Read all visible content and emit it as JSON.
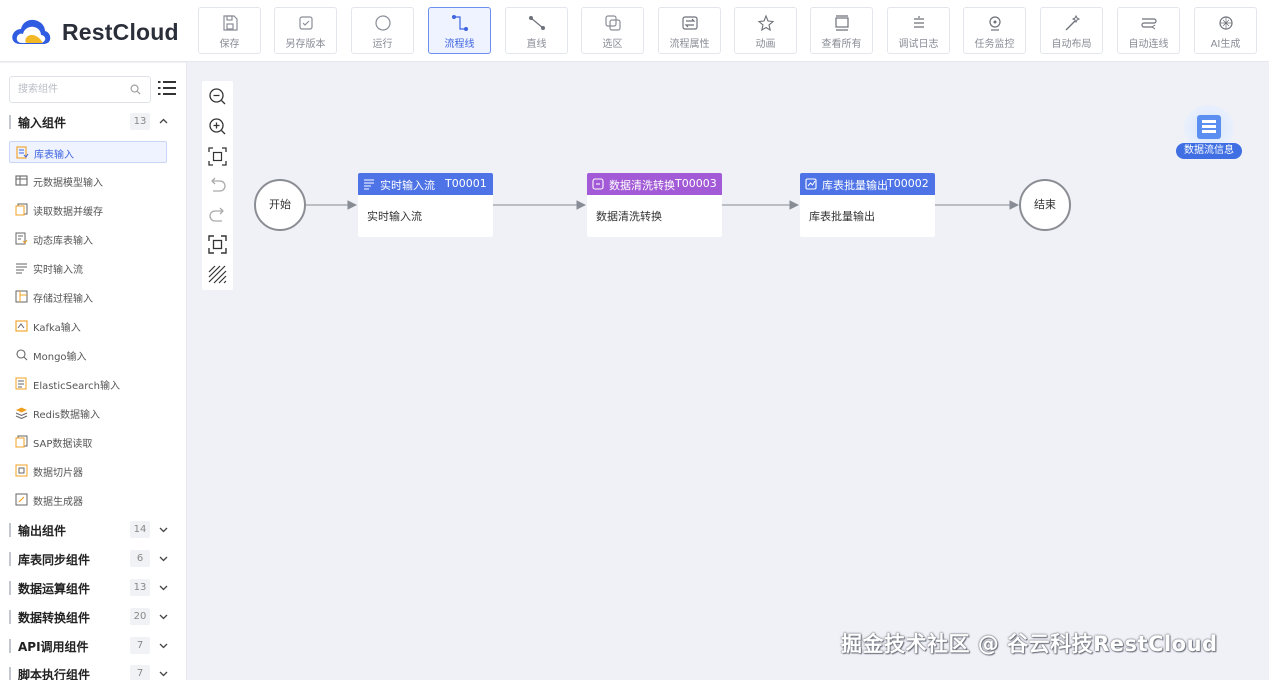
{
  "brand": {
    "name": "RestCloud"
  },
  "toolbar": [
    {
      "label": "保存",
      "icon": "save-icon"
    },
    {
      "label": "另存版本",
      "icon": "save-version-icon"
    },
    {
      "label": "运行",
      "icon": "run-icon"
    },
    {
      "label": "流程线",
      "icon": "flow-line-icon",
      "active": true
    },
    {
      "label": "直线",
      "icon": "straight-line-icon"
    },
    {
      "label": "选区",
      "icon": "select-area-icon"
    },
    {
      "label": "流程属性",
      "icon": "flow-properties-icon"
    },
    {
      "label": "动画",
      "icon": "animation-icon"
    },
    {
      "label": "查看所有",
      "icon": "view-all-icon"
    },
    {
      "label": "调试日志",
      "icon": "debug-log-icon"
    },
    {
      "label": "任务监控",
      "icon": "task-monitor-icon"
    },
    {
      "label": "自动布局",
      "icon": "auto-layout-icon"
    },
    {
      "label": "自动连线",
      "icon": "auto-connect-icon"
    },
    {
      "label": "AI生成",
      "icon": "ai-generate-icon"
    }
  ],
  "sidebar": {
    "search_placeholder": "搜索组件",
    "input_group": {
      "title": "输入组件",
      "count": "13",
      "expanded": true
    },
    "input_items": [
      {
        "label": "库表输入",
        "icon": "table-input-icon",
        "active": true
      },
      {
        "label": "元数据模型输入",
        "icon": "metadata-model-icon"
      },
      {
        "label": "读取数据并缓存",
        "icon": "read-cache-icon"
      },
      {
        "label": "动态库表输入",
        "icon": "dynamic-table-icon"
      },
      {
        "label": "实时输入流",
        "icon": "realtime-stream-icon"
      },
      {
        "label": "存储过程输入",
        "icon": "stored-procedure-icon"
      },
      {
        "label": "Kafka输入",
        "icon": "kafka-icon"
      },
      {
        "label": "Mongo输入",
        "icon": "mongo-icon"
      },
      {
        "label": "ElasticSearch输入",
        "icon": "elasticsearch-icon"
      },
      {
        "label": "Redis数据输入",
        "icon": "redis-icon"
      },
      {
        "label": "SAP数据读取",
        "icon": "sap-icon"
      },
      {
        "label": "数据切片器",
        "icon": "data-slicer-icon"
      },
      {
        "label": "数据生成器",
        "icon": "data-generator-icon"
      }
    ],
    "groups": [
      {
        "title": "输出组件",
        "count": "14"
      },
      {
        "title": "库表同步组件",
        "count": "6"
      },
      {
        "title": "数据运算组件",
        "count": "13"
      },
      {
        "title": "数据转换组件",
        "count": "20"
      },
      {
        "title": "API调用组件",
        "count": "7"
      },
      {
        "title": "脚本执行组件",
        "count": "7"
      }
    ]
  },
  "canvas_tools": [
    "zoom-out-icon",
    "zoom-in-icon",
    "fit-view-icon",
    "undo-icon",
    "redo-icon",
    "fullscreen-icon",
    "grid-pattern-icon"
  ],
  "flow": {
    "start": "开始",
    "end": "结束",
    "nodes": [
      {
        "name": "实时输入流",
        "id": "T00001",
        "body": "实时输入流",
        "color": "#4e73e6"
      },
      {
        "name": "数据清洗转换",
        "id": "T00003",
        "body": "数据清洗转换",
        "color": "#a25ad6"
      },
      {
        "name": "库表批量输出",
        "id": "T00002",
        "body": "库表批量输出",
        "color": "#4e73e6"
      }
    ]
  },
  "dataflow_info": {
    "label": "数据流信息"
  },
  "watermark": "掘金技术社区 @ 谷云科技RestCloud"
}
